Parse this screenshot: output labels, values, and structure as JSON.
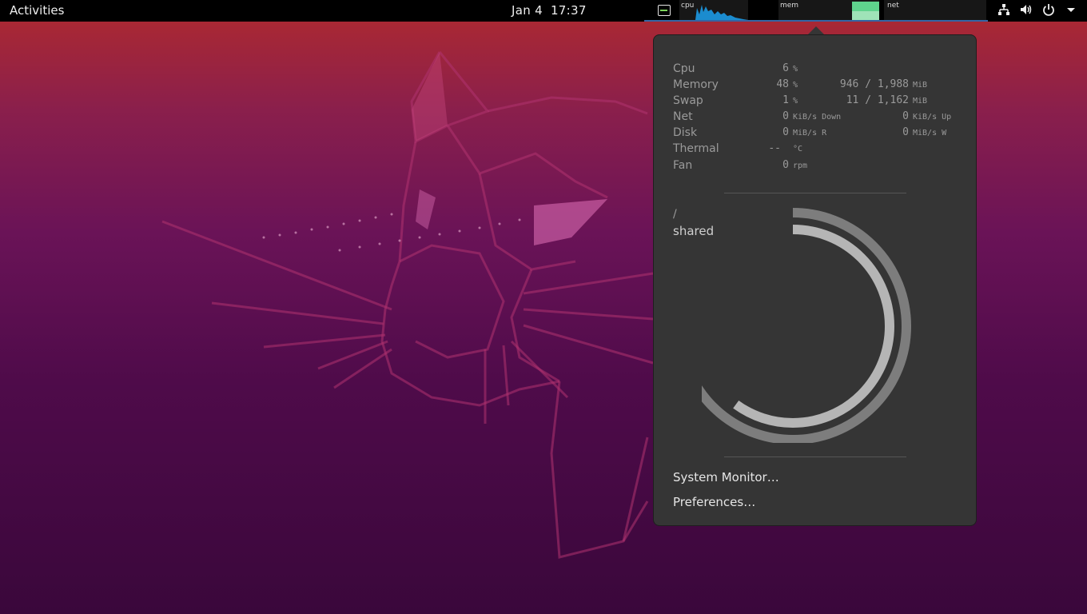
{
  "topbar": {
    "activities": "Activities",
    "date": "Jan 4",
    "time": "17:37",
    "graphs": {
      "cpu_label": "cpu",
      "mem_label": "mem",
      "net_label": "net"
    },
    "icons": [
      "network-icon",
      "volume-icon",
      "power-icon",
      "menu-arrow-icon"
    ]
  },
  "popup": {
    "stats": {
      "cpu": {
        "name": "Cpu",
        "value": "6",
        "unit": "%"
      },
      "memory": {
        "name": "Memory",
        "value": "48",
        "unit": "%",
        "value2": "946 / 1,988",
        "unit2": "MiB"
      },
      "swap": {
        "name": "Swap",
        "value": "1",
        "unit": "%",
        "value2": "11 / 1,162",
        "unit2": "MiB"
      },
      "net": {
        "name": "Net",
        "value": "0",
        "unit": "KiB/s Down",
        "value2": "0",
        "unit2": "KiB/s Up"
      },
      "disk": {
        "name": "Disk",
        "value": "0",
        "unit": "MiB/s R",
        "value2": "0",
        "unit2": "MiB/s W"
      },
      "thermal": {
        "name": "Thermal",
        "value": "--",
        "unit": "°C"
      },
      "fan": {
        "name": "Fan",
        "value": "0",
        "unit": "rpm"
      }
    },
    "disk_usage": {
      "mount_root": "/",
      "mount_shared": "shared",
      "root_fraction": 0.72,
      "shared_fraction": 0.6
    },
    "menu": {
      "system_monitor": "System Monitor…",
      "preferences": "Preferences…"
    }
  },
  "colors": {
    "topbar": "#000000",
    "popup_bg": "#353535",
    "accent_blue": "#3465a4",
    "cpu_graph": "#1b8ccf",
    "mem_graph": "#5fd38d"
  }
}
